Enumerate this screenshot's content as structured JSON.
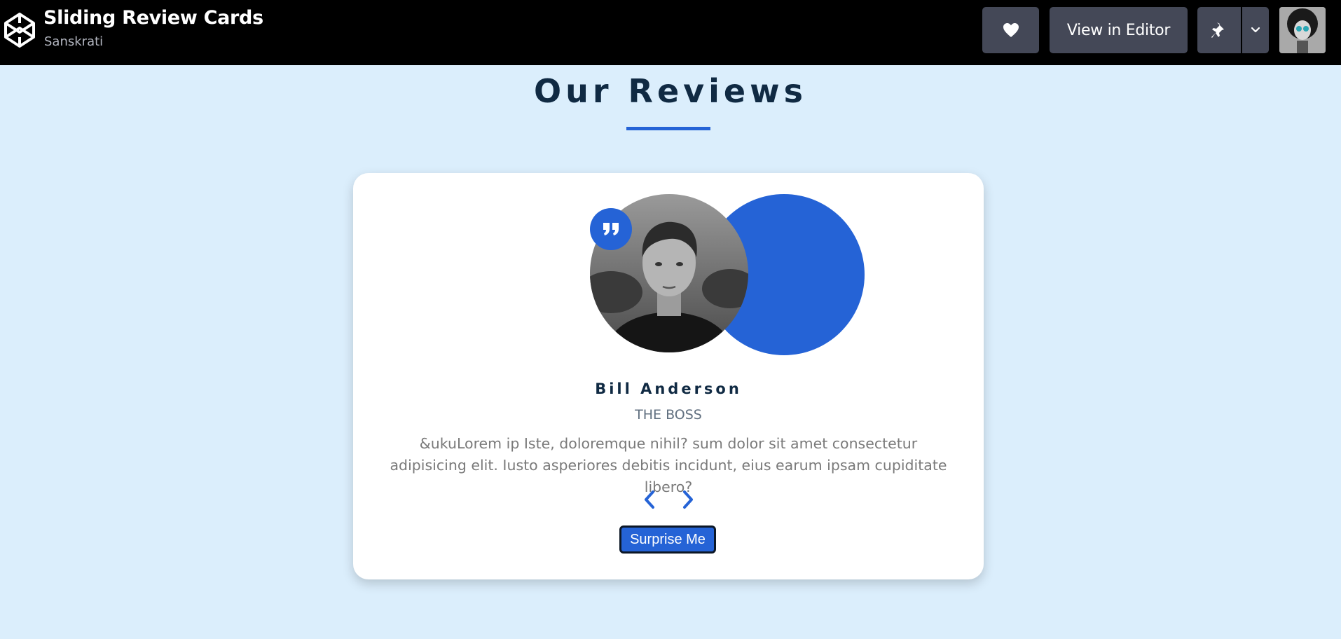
{
  "topbar": {
    "title": "Sliding Review Cards",
    "author": "Sanskrati",
    "view_editor_label": "View in Editor",
    "icons": [
      "codepen-logo-icon",
      "heart-icon",
      "pin-icon",
      "chevron-down-icon"
    ]
  },
  "page": {
    "heading": "Our Reviews"
  },
  "review": {
    "name": "Bill Anderson",
    "role": "THE BOSS",
    "text": "&ukuLorem ip Iste, doloremque nihil? sum dolor sit amet consectetur adipisicing elit. Iusto asperiores debitis incidunt, eius earum ipsam cupiditate libero?",
    "surprise_label": "Surprise Me"
  },
  "colors": {
    "accent": "#2563d6",
    "background": "#dbeefc",
    "topbar": "#000000",
    "heading": "#102a43",
    "button_bg": "#444857"
  }
}
